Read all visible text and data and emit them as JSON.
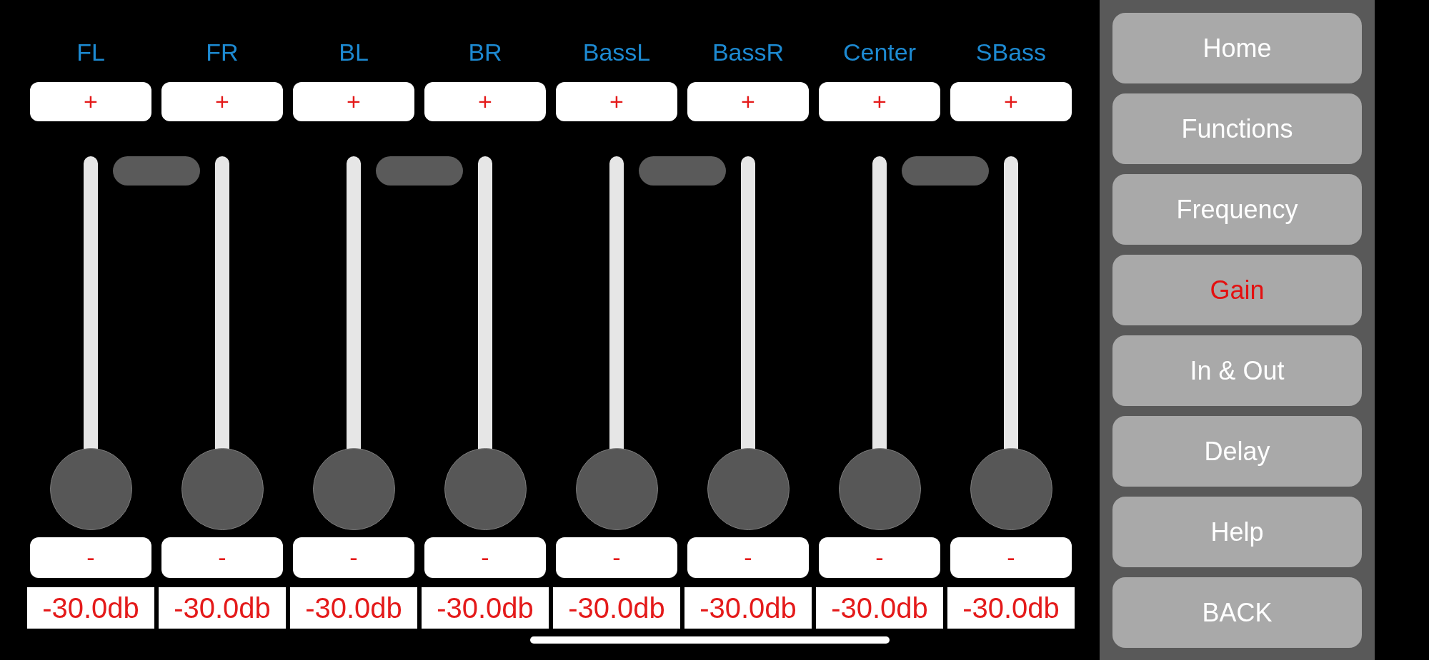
{
  "channels": [
    {
      "name": "FL",
      "plus": "+",
      "level": 0,
      "minus": "-",
      "reading": "-30.0db"
    },
    {
      "name": "FR",
      "plus": "+",
      "level": 0,
      "minus": "-",
      "reading": "-30.0db"
    },
    {
      "name": "BL",
      "plus": "+",
      "level": 0,
      "minus": "-",
      "reading": "-30.0db"
    },
    {
      "name": "BR",
      "plus": "+",
      "level": 0,
      "minus": "-",
      "reading": "-30.0db"
    },
    {
      "name": "BassL",
      "plus": "+",
      "level": 0,
      "minus": "-",
      "reading": "-30.0db"
    },
    {
      "name": "BassR",
      "plus": "+",
      "level": 0,
      "minus": "-",
      "reading": "-30.0db"
    },
    {
      "name": "Center",
      "plus": "+",
      "level": 0,
      "minus": "-",
      "reading": "-30.0db"
    },
    {
      "name": "SBass",
      "plus": "+",
      "level": 0,
      "minus": "-",
      "reading": "-30.0db"
    }
  ],
  "menu": [
    {
      "label": "Home",
      "selected": false
    },
    {
      "label": "Functions",
      "selected": false
    },
    {
      "label": "Frequency",
      "selected": false
    },
    {
      "label": "Gain",
      "selected": true
    },
    {
      "label": "In & Out",
      "selected": false
    },
    {
      "label": "Delay",
      "selected": false
    },
    {
      "label": "Help",
      "selected": false
    },
    {
      "label": "BACK",
      "selected": false
    }
  ]
}
